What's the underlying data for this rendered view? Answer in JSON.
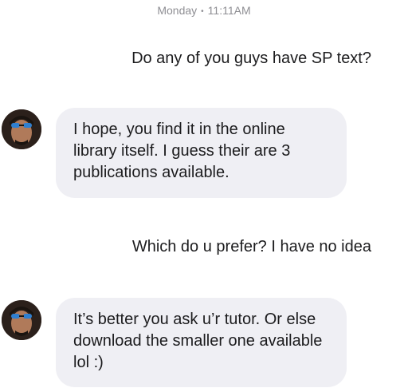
{
  "thread": {
    "timestamp_day": "Monday",
    "timestamp_time": "11:11AM"
  },
  "messages": [
    {
      "direction": "outgoing",
      "text": "Do any of you guys have SP text?"
    },
    {
      "direction": "incoming",
      "text": "I hope, you find it in the online library itself. I guess their are 3 publications available."
    },
    {
      "direction": "outgoing",
      "text": "Which do u prefer? I have no idea"
    },
    {
      "direction": "incoming",
      "text": "It’s better you ask u’r tutor. Or else download the smaller one available lol :)"
    }
  ],
  "colors": {
    "incoming_bubble": "#efeff4",
    "text": "#1c1c1e",
    "timestamp": "#8e8e93"
  }
}
